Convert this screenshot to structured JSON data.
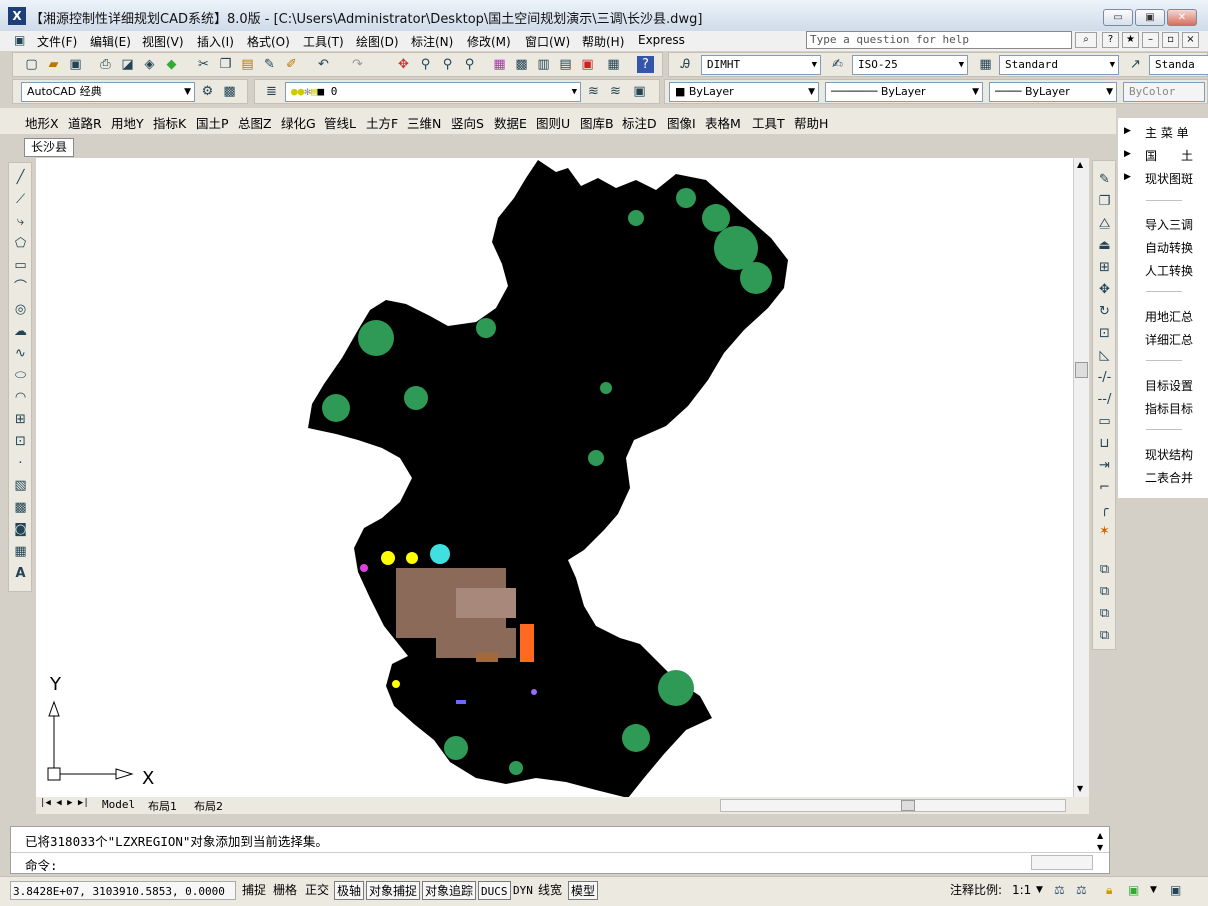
{
  "window": {
    "title": "【湘源控制性详细规划CAD系统】8.0版 - [C:\\Users\\Administrator\\Desktop\\国土空间规划演示\\三调\\长沙县.dwg]",
    "min": "▭",
    "max": "▣",
    "close": "✕"
  },
  "menu": [
    "文件(F)",
    "编辑(E)",
    "视图(V)",
    "插入(I)",
    "格式(O)",
    "工具(T)",
    "绘图(D)",
    "标注(N)",
    "修改(M)",
    "窗口(W)",
    "帮助(H)",
    "Express"
  ],
  "help": {
    "placeholder": "Type a question for help"
  },
  "toolbar": {
    "dimstyle": "DIMHT",
    "textstyle": "ISO-25",
    "tablestyle": "Standard",
    "mleaderstyle": "Standa",
    "workspace": "AutoCAD 经典",
    "layer": "0",
    "color": "ByLayer",
    "linetype": "ByLayer",
    "lineweight": "ByLayer",
    "plotstyle": "ByColor"
  },
  "custom_menu": [
    "地形X",
    "道路R",
    "用地Y",
    "指标K",
    "国土P",
    "总图Z",
    "绿化G",
    "管线L",
    "土方F",
    "三维N",
    "竖向S",
    "数据E",
    "图则U",
    "图库B",
    "标注D",
    "图像I",
    "表格M",
    "工具T",
    "帮助H"
  ],
  "doc_tab": "长沙县",
  "ucs": {
    "x": "X",
    "y": "Y"
  },
  "layout_tabs": [
    "Model",
    "布局1",
    "布局2"
  ],
  "right_panel": {
    "top": [
      "主 菜 单",
      "国　　土",
      "现状图斑"
    ],
    "group1": [
      "导入三调",
      "自动转换",
      "人工转换"
    ],
    "group2": [
      "用地汇总",
      "详细汇总"
    ],
    "group3": [
      "目标设置",
      "指标目标"
    ],
    "group4": [
      "现状结构",
      "二表合并"
    ]
  },
  "command": {
    "history": "已将318033个\"LZXREGION\"对象添加到当前选择集。",
    "prompt": "命令:"
  },
  "status": {
    "coords": "3.8428E+07, 3103910.5853, 0.0000",
    "toggles": [
      "捕捉",
      "栅格",
      "正交",
      "极轴",
      "对象捕捉",
      "对象追踪",
      "DUCS",
      "DYN",
      "线宽",
      "模型"
    ],
    "annot_label": "注释比例:",
    "annot_scale": "1:1"
  }
}
